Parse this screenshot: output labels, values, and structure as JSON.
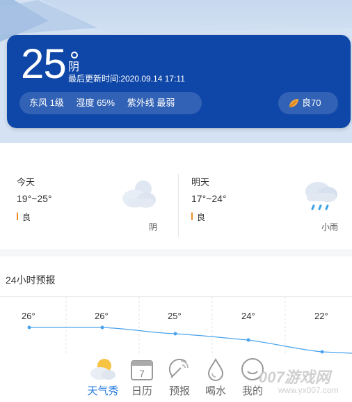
{
  "current": {
    "temperature": "25",
    "condition": "阴",
    "updated": "最后更新时间:2020.09.14 17:11",
    "wind": "东风 1级",
    "humidity": "湿度 65%",
    "uv": "紫外线 最弱",
    "aqi": "良70",
    "aqi_icon": "leaf-icon"
  },
  "daily": [
    {
      "label": "今天",
      "range": "19°~25°",
      "aqi": "良",
      "condition": "阴",
      "icon": "cloudy-icon"
    },
    {
      "label": "明天",
      "range": "17°~24°",
      "aqi": "良",
      "condition": "小雨",
      "icon": "light-rain-icon"
    }
  ],
  "hourly": {
    "title": "24小时预报",
    "temps": [
      "26°",
      "26°",
      "25°",
      "24°",
      "22°"
    ]
  },
  "tabs": [
    {
      "label": "天气秀",
      "icon": "weather-show-icon",
      "active": true
    },
    {
      "label": "日历",
      "icon": "calendar-icon",
      "day": "7"
    },
    {
      "label": "预报",
      "icon": "satellite-icon"
    },
    {
      "label": "喝水",
      "icon": "water-drop-icon"
    },
    {
      "label": "我的",
      "icon": "profile-icon"
    }
  ],
  "watermark": {
    "text": "007游戏网",
    "sub": "www.yx007.com"
  },
  "colors": {
    "card": "#0f47a8",
    "accent": "#2a7de1",
    "aqi_orange": "#f08a2a"
  }
}
